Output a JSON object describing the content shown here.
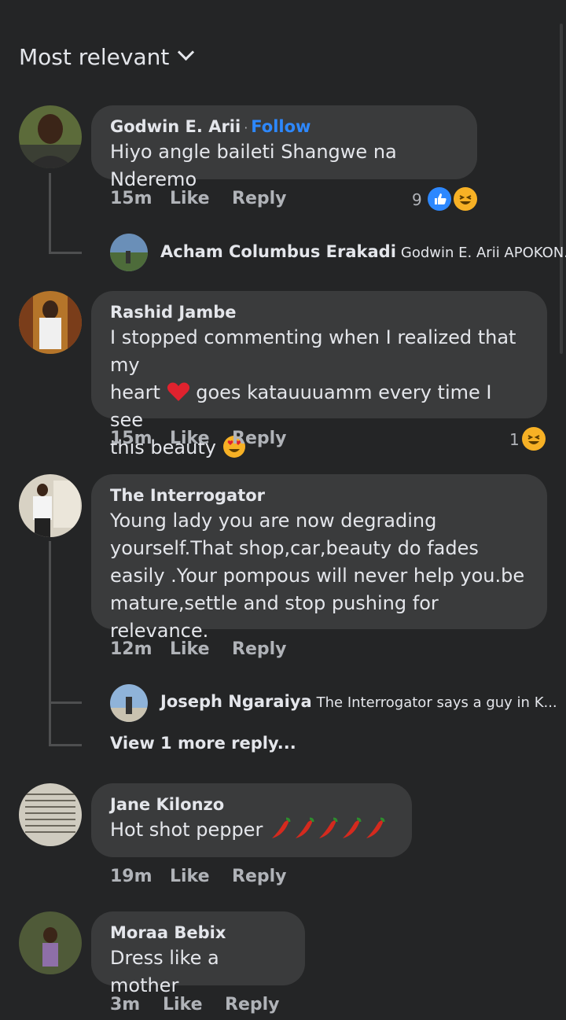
{
  "header": {
    "sort_label": "Most relevant"
  },
  "comments": [
    {
      "author": "Godwin E. Arii",
      "follow": "Follow",
      "text": "Hiyo angle baileti Shangwe na Nderemo",
      "time": "15m",
      "like": "Like",
      "reply": "Reply",
      "reaction_count": "9",
      "replies": [
        {
          "author": "Acham Columbus Erakadi",
          "snippet": "Godwin E. Arii APOKON..."
        }
      ]
    },
    {
      "author": "Rashid Jambe",
      "text_parts": [
        "I stopped commenting when I realized that my",
        "heart",
        "goes katauuuamm every time I see",
        "this beauty"
      ],
      "time": "15m",
      "like": "Like",
      "reply": "Reply",
      "reaction_count": "1"
    },
    {
      "author": "The Interrogator",
      "text": "Young lady you are now degrading yourself.That shop,car,beauty do fades easily .Your pompous will never help you.be mature,settle and stop pushing for relevance.",
      "time": "12m",
      "like": "Like",
      "reply": "Reply",
      "replies": [
        {
          "author": "Joseph Ngaraiya",
          "snippet": "The Interrogator says a guy in K..."
        }
      ],
      "view_more": "View 1 more reply..."
    },
    {
      "author": "Jane Kilonzo",
      "text": "Hot shot pepper",
      "time": "19m",
      "like": "Like",
      "reply": "Reply"
    },
    {
      "author": "Moraa Bebix",
      "text": "Dress like a mother",
      "time": "3m",
      "like": "Like",
      "reply": "Reply"
    }
  ],
  "colors": {
    "background": "#242526",
    "bubble": "#3a3b3c",
    "link": "#2d88ff",
    "muted": "#b0b3b8"
  },
  "icons": [
    "chevron-down-icon",
    "like-reaction-icon",
    "haha-reaction-icon",
    "heart-emoji",
    "heart-eyes-emoji",
    "chili-pepper-emoji"
  ]
}
